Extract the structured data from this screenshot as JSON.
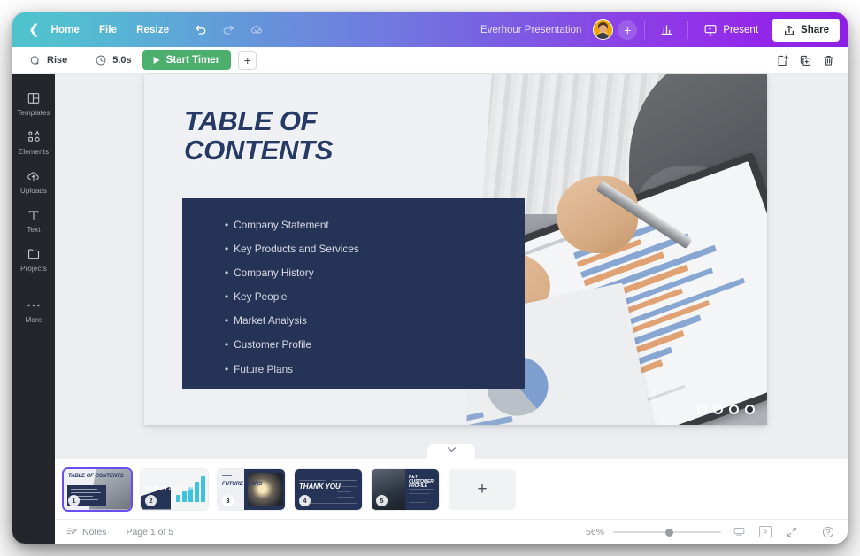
{
  "app": {
    "title": "Everhour Presentation"
  },
  "top_bar": {
    "back_icon": "chevron-left-icon",
    "home": "Home",
    "file": "File",
    "resize": "Resize",
    "undo_icon": "undo-icon",
    "redo_icon": "redo-icon",
    "cloud_icon": "cloud-sync-icon",
    "avatar_icon": "user-avatar",
    "add_collaborator": "+",
    "stats_icon": "bar-chart-icon",
    "present_icon": "presentation-screen-icon",
    "present": "Present",
    "share_icon": "upload-share-icon",
    "share": "Share"
  },
  "tool_bar": {
    "animation_icon": "animation-rise-icon",
    "animation": "Rise",
    "timer_icon": "clock-icon",
    "timer": "5.0s",
    "start_timer_icon": "play-icon",
    "start_timer": "Start Timer",
    "add_animation": "+",
    "add_page_icon": "add-page-icon",
    "duplicate_icon": "duplicate-page-icon",
    "delete_icon": "trash-icon"
  },
  "sidebar": {
    "items": [
      {
        "label": "Templates",
        "icon": "templates-icon"
      },
      {
        "label": "Elements",
        "icon": "elements-icon"
      },
      {
        "label": "Uploads",
        "icon": "cloud-upload-icon"
      },
      {
        "label": "Text",
        "icon": "text-icon"
      },
      {
        "label": "Projects",
        "icon": "folder-icon"
      },
      {
        "label": "More",
        "icon": "more-dots-icon"
      }
    ]
  },
  "slide": {
    "title": "TABLE OF\nCONTENTS",
    "toc": [
      "Company Statement",
      "Key Products and Services",
      "Company History",
      "Key People",
      "Market Analysis",
      "Customer Profile",
      "Future Plans"
    ],
    "bullet": "•",
    "dots": 4,
    "active_dot": 4,
    "navy_color": "#253356",
    "title_color": "#263a66"
  },
  "canvas": {
    "collapse_icon": "chevron-down-icon"
  },
  "thumbnails": [
    {
      "number": "1",
      "title": "TABLE OF\nCONTENTS",
      "kind": "toc"
    },
    {
      "number": "2",
      "title": "MARKET\nANALYSIS",
      "kind": "chart"
    },
    {
      "number": "3",
      "title": "FUTURE\nPLANS",
      "kind": "photo"
    },
    {
      "number": "4",
      "title": "THANK\nYOU",
      "kind": "thanks"
    },
    {
      "number": "5",
      "title": "KEY\nCUSTOMER\nPROFILE",
      "kind": "profile"
    }
  ],
  "add_slide": "+",
  "status_bar": {
    "notes_icon": "notes-icon",
    "notes": "Notes",
    "page": "Page 1 of 5",
    "zoom": "56%",
    "monitor_icon": "monitor-icon",
    "pages_icon": "pages-grid-icon",
    "pages_count": "5",
    "fullscreen_icon": "expand-icon",
    "help_icon": "help-circle-icon"
  }
}
